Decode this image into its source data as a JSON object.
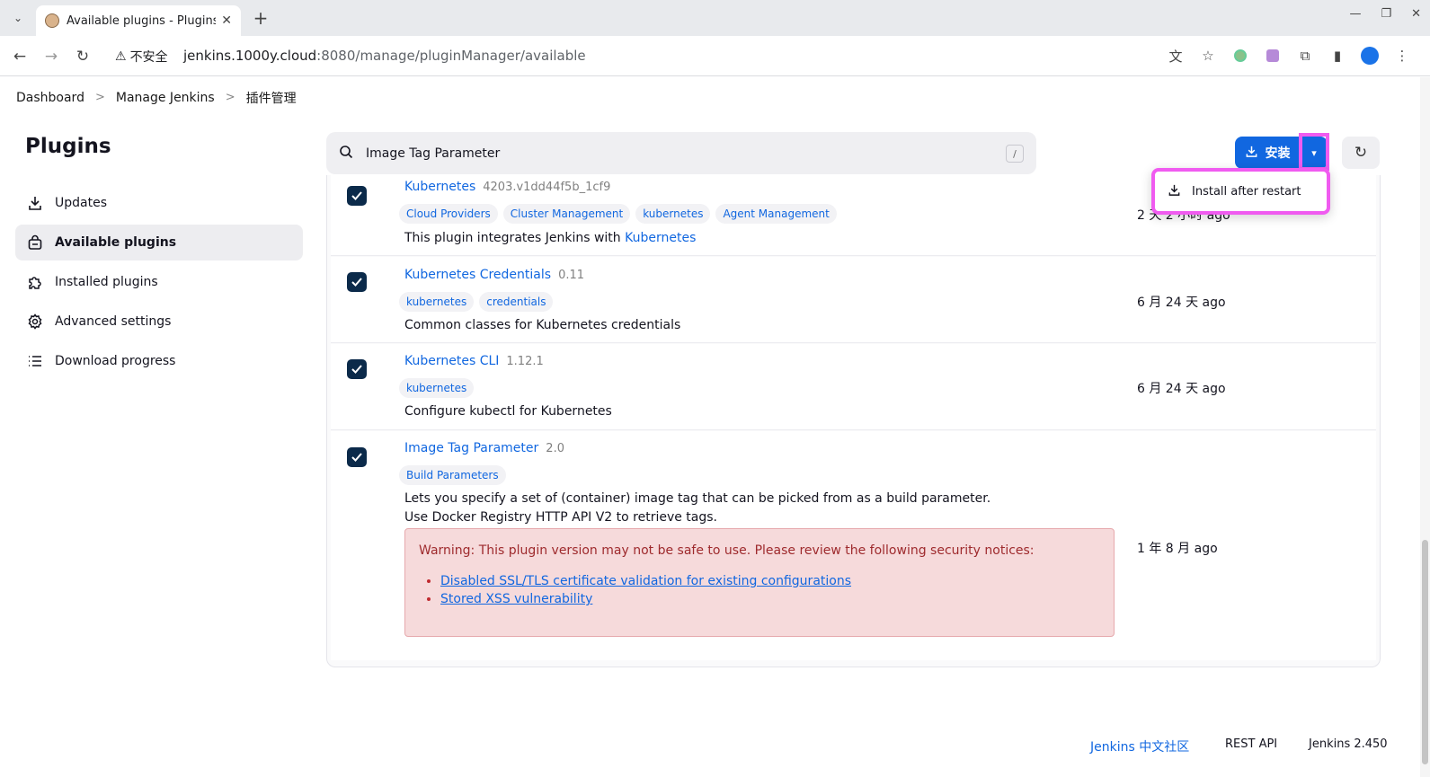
{
  "browser": {
    "tab_title": "Available plugins - Plugins [",
    "security_label": "不安全",
    "url_host": "jenkins.1000y.cloud",
    "url_port_path": ":8080/manage/pluginManager/available"
  },
  "breadcrumb": {
    "items": [
      "Dashboard",
      "Manage Jenkins",
      "插件管理"
    ]
  },
  "sidebar": {
    "title": "Plugins",
    "items": [
      {
        "label": "Updates",
        "icon": "download-icon"
      },
      {
        "label": "Available plugins",
        "icon": "shopping-bag-icon",
        "active": true
      },
      {
        "label": "Installed plugins",
        "icon": "puzzle-icon"
      },
      {
        "label": "Advanced settings",
        "icon": "gear-icon"
      },
      {
        "label": "Download progress",
        "icon": "list-icon"
      }
    ]
  },
  "search": {
    "value": "Image Tag Parameter",
    "shortcut": "/"
  },
  "toolbar": {
    "install_label": "安装",
    "dropdown_item": "Install after restart"
  },
  "plugins": [
    {
      "name": "Kubernetes",
      "version": "4203.v1dd44f5b_1cf9",
      "tags": [
        "Cloud Providers",
        "Cluster Management",
        "kubernetes",
        "Agent Management"
      ],
      "desc_prefix": "This plugin integrates Jenkins with ",
      "desc_link": "Kubernetes",
      "released": "2 天 2 小时 ago",
      "checked": true
    },
    {
      "name": "Kubernetes Credentials",
      "version": "0.11",
      "tags": [
        "kubernetes",
        "credentials"
      ],
      "desc": "Common classes for Kubernetes credentials",
      "released": "6 月 24 天 ago",
      "checked": true
    },
    {
      "name": "Kubernetes CLI",
      "version": "1.12.1",
      "tags": [
        "kubernetes"
      ],
      "desc": "Configure kubectl for Kubernetes",
      "released": "6 月 24 天 ago",
      "checked": true
    },
    {
      "name": "Image Tag Parameter",
      "version": "2.0",
      "tags": [
        "Build Parameters"
      ],
      "desc_line1": "Lets you specify a set of (container) image tag that can be picked from as a build parameter.",
      "desc_line2": "Use Docker Registry HTTP API V2 to retrieve tags.",
      "released": "1 年 8 月 ago",
      "checked": true,
      "warning": {
        "text": "Warning: This plugin version may not be safe to use. Please review the following security notices:",
        "links": [
          "Disabled SSL/TLS certificate validation for existing configurations",
          "Stored XSS vulnerability"
        ]
      }
    }
  ],
  "footer": {
    "community": "Jenkins 中文社区",
    "rest_api": "REST API",
    "version": "Jenkins 2.450"
  },
  "colors": {
    "accent": "#1167e0",
    "highlight": "#f05bf0",
    "warning_bg": "#f6dadb",
    "checkbox": "#0b2a4a"
  }
}
